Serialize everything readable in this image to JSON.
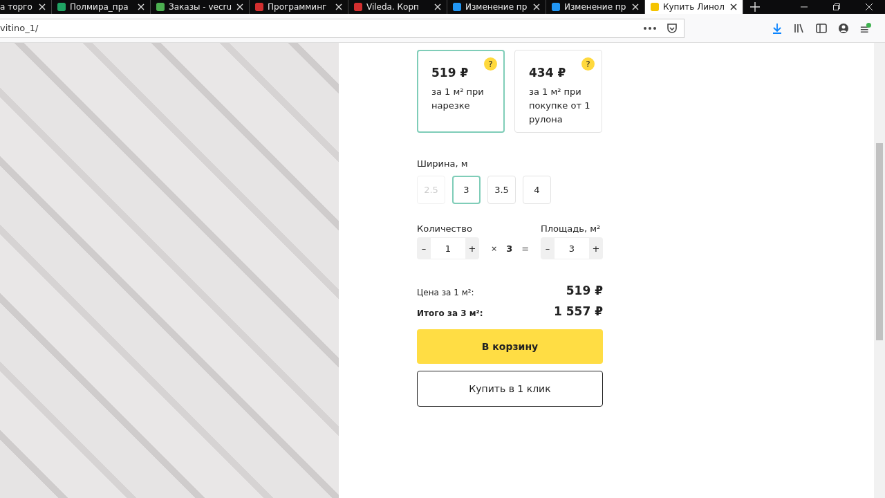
{
  "tabs": [
    {
      "title": "а торго",
      "selected": false
    },
    {
      "title": "Полмира_пра",
      "selected": false,
      "color": "#1fa463"
    },
    {
      "title": "Заказы - vecru",
      "selected": false,
      "color": "#4caf50"
    },
    {
      "title": "Программинг",
      "selected": false,
      "color": "#d32f2f"
    },
    {
      "title": "Vileda. Корп",
      "selected": false,
      "color": "#d32f2f"
    },
    {
      "title": "Изменение пр",
      "selected": false,
      "color": "#2196f3"
    },
    {
      "title": "Изменение пр",
      "selected": false,
      "color": "#2196f3"
    },
    {
      "title": "Купить Линол",
      "selected": true,
      "color": "#f5c400"
    }
  ],
  "address_bar": {
    "url": "vitino_1/"
  },
  "price_options": [
    {
      "price": "519 ₽",
      "description": "за 1 м² при нарезке",
      "help": "?",
      "selected": true
    },
    {
      "price": "434 ₽",
      "description": "за 1 м² при покупке от 1 рулона",
      "help": "?",
      "selected": false
    }
  ],
  "width": {
    "label": "Ширина, м",
    "options": [
      {
        "value": "2.5",
        "selected": false,
        "disabled": true
      },
      {
        "value": "3",
        "selected": true,
        "disabled": false
      },
      {
        "value": "3.5",
        "selected": false,
        "disabled": false
      },
      {
        "value": "4",
        "selected": false,
        "disabled": false
      }
    ]
  },
  "quantity": {
    "label": "Количество",
    "minus": "–",
    "value": "1",
    "plus": "+"
  },
  "multiplier": {
    "sign": "×",
    "value": "3",
    "equals": "="
  },
  "area": {
    "label": "Площадь, м²",
    "minus": "–",
    "value": "3",
    "plus": "+"
  },
  "price_per_m2": {
    "label": "Цена за 1 м²:",
    "value": "519 ₽"
  },
  "total": {
    "label": "Итого за 3 м²:",
    "value": "1 557 ₽"
  },
  "buttons": {
    "cart": "В корзину",
    "one_click": "Купить в 1 клик"
  }
}
